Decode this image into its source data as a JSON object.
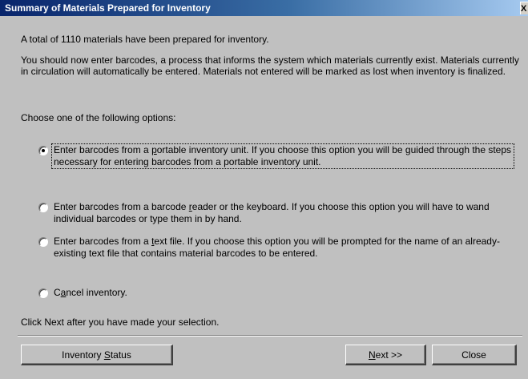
{
  "window": {
    "title": "Summary of Materials Prepared for Inventory",
    "close_glyph": "X"
  },
  "summary_text": "A total of 1110 materials have been prepared for inventory.",
  "instructions_text": "You should now enter barcodes, a process that informs the system which materials currently exist. Materials currently in circulation will automatically be entered.  Materials not entered will be marked as lost when inventory is finalized.",
  "choose_text": "Choose one of the following options:",
  "options": [
    {
      "pre": "Enter barcodes from a ",
      "accel": "p",
      "post": "ortable inventory unit.  If you choose this option you will be guided through the steps necessary for entering barcodes from a portable inventory unit.",
      "selected": true
    },
    {
      "pre": "Enter barcodes from a barcode ",
      "accel": "r",
      "post": "eader or the keyboard.  If you choose this option you will have to wand individual barcodes or type them in by hand.",
      "selected": false
    },
    {
      "pre": "Enter barcodes from a ",
      "accel": "t",
      "post": "ext file.  If you choose this option you will be prompted for the name of an already-existing text file that contains material barcodes to be entered.",
      "selected": false
    },
    {
      "pre": "C",
      "accel": "a",
      "post": "ncel inventory.",
      "selected": false
    }
  ],
  "footer_text": "Click Next after you have made your selection.",
  "buttons": {
    "status": {
      "pre": "Inventory ",
      "accel": "S",
      "post": "tatus"
    },
    "next": {
      "pre": "",
      "accel": "N",
      "post": "ext >>"
    },
    "close": {
      "pre": "Close",
      "accel": "",
      "post": ""
    }
  },
  "colors": {
    "dialog_bg": "#c0c0c0",
    "titlebar_start": "#08246b",
    "titlebar_end": "#a6caf0"
  }
}
